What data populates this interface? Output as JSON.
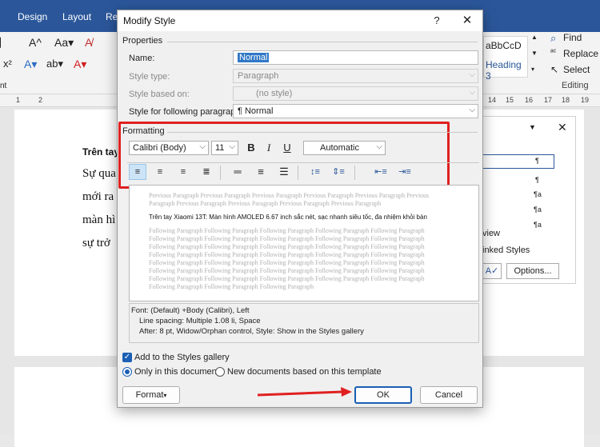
{
  "ribbon": {
    "tabs": [
      "Design",
      "Layout",
      "Ref"
    ],
    "find_label": "Find",
    "replace_label": "Replace",
    "select_label": "Select",
    "group_editing": "Editing",
    "style_sample1": "aBbCcD",
    "style_sample2": "Heading 3"
  },
  "ruler": {
    "ticks": [
      "1",
      "2",
      "14",
      "15",
      "16",
      "17",
      "18",
      "19"
    ]
  },
  "document": {
    "lines": [
      "Trên tay",
      "Sự qua",
      "mới ra",
      "màn hì",
      "sự trở"
    ]
  },
  "styles_pane": {
    "marks": [
      "¶",
      "¶",
      "¶a",
      "¶a",
      "¶a"
    ],
    "preview_label": "view",
    "linked_label": "inked Styles",
    "options_label": "Options..."
  },
  "dialog": {
    "title": "Modify Style",
    "help": "?",
    "close": "✕",
    "properties_label": "Properties",
    "name_label": "Name:",
    "name_value": "Normal",
    "style_type_label": "Style type:",
    "style_type_value": "Paragraph",
    "based_on_label": "Style based on:",
    "based_on_value": "(no style)",
    "following_label": "Style for following paragraph:",
    "following_value": "¶ Normal",
    "formatting_label": "Formatting",
    "font_value": "Calibri (Body)",
    "size_value": "11",
    "bold": "B",
    "italic": "I",
    "underline": "U",
    "color_value": "Automatic",
    "preview": {
      "previous": [
        "Previous Paragraph Previous Paragraph Previous Paragraph Previous Paragraph Previous Paragraph Previous",
        "Paragraph Previous Paragraph Previous Paragraph Previous Paragraph Previous Paragraph"
      ],
      "sample": "Trên tay Xiaomi 13T: Màn hình AMOLED 6.67 inch sắc nét, sạc nhanh siêu tốc, đa nhiệm khỏi bàn",
      "following": [
        "Following Paragraph Following Paragraph Following Paragraph Following Paragraph Following Paragraph",
        "Following Paragraph Following Paragraph Following Paragraph Following Paragraph Following Paragraph",
        "Following Paragraph Following Paragraph Following Paragraph Following Paragraph Following Paragraph",
        "Following Paragraph Following Paragraph Following Paragraph Following Paragraph Following Paragraph",
        "Following Paragraph Following Paragraph Following Paragraph Following Paragraph Following Paragraph",
        "Following Paragraph Following Paragraph Following Paragraph Following Paragraph Following Paragraph",
        "Following Paragraph Following Paragraph Following Paragraph Following Paragraph Following Paragraph",
        "Following Paragraph Following Paragraph Following Paragraph"
      ]
    },
    "description": [
      "Font: (Default) +Body (Calibri), Left",
      "Line spacing:  Multiple 1.08 li, Space",
      "After:  8 pt, Widow/Orphan control, Style: Show in the Styles gallery"
    ],
    "add_to_gallery_label": "Add to the Styles gallery",
    "only_doc_label": "Only in this document",
    "new_docs_label": "New documents based on this template",
    "format_label": "Format",
    "ok_label": "OK",
    "cancel_label": "Cancel"
  },
  "colors": {
    "accent": "#1a5fb4",
    "highlight": "#e02020",
    "ribbon": "#2b579a"
  }
}
